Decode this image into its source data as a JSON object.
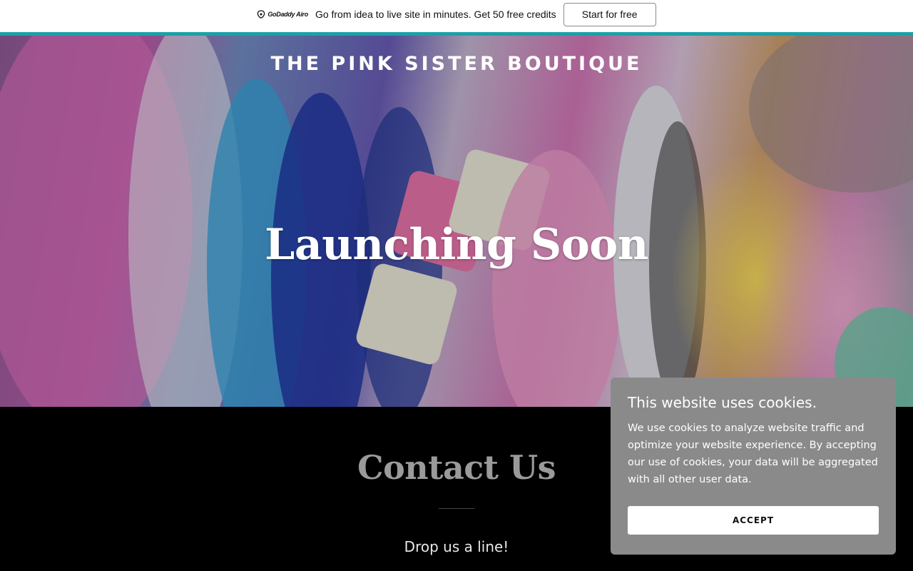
{
  "promo": {
    "logo_text": "GoDaddy Airo",
    "message": "Go from idea to live site in minutes. Get 50 free credits",
    "button_label": "Start for free",
    "accent_color": "#1ba0a8"
  },
  "hero": {
    "site_title": "THE PINK SISTER BOUTIQUE",
    "heading": "Launching Soon"
  },
  "contact": {
    "title": "Contact Us",
    "subtitle": "Drop us a line!"
  },
  "cookie_banner": {
    "title": "This website uses cookies.",
    "text": "We use cookies to analyze website traffic and optimize your website experience. By accepting our use of cookies, your data will be aggregated with all other user data.",
    "accept_label": "ACCEPT",
    "background_color": "#8a8a8a"
  }
}
